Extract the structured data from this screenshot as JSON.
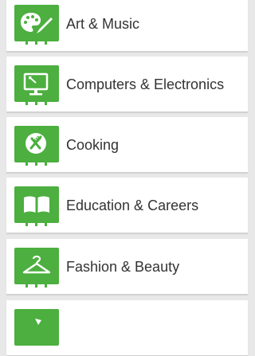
{
  "categories": [
    {
      "label": "Art & Music",
      "icon": "palette-icon"
    },
    {
      "label": "Computers & Electronics",
      "icon": "monitor-icon"
    },
    {
      "label": "Cooking",
      "icon": "plate-utensils-icon"
    },
    {
      "label": "Education & Careers",
      "icon": "open-book-icon"
    },
    {
      "label": "Fashion & Beauty",
      "icon": "hanger-icon"
    },
    {
      "label": "",
      "icon": "category-icon"
    }
  ],
  "colors": {
    "accent": "#4caf3f",
    "background": "#e8e8e8",
    "card": "#ffffff",
    "text": "#333333"
  }
}
